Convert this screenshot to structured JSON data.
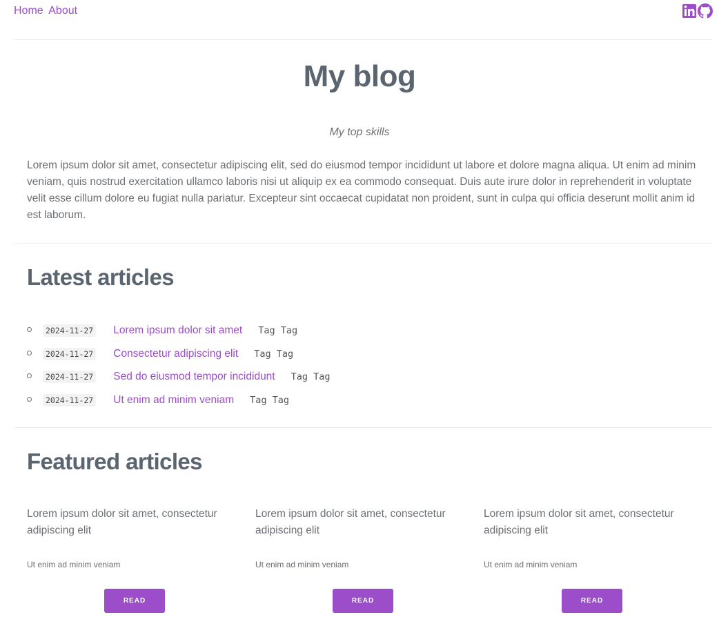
{
  "nav": {
    "links": [
      "Home",
      "About"
    ]
  },
  "social": {
    "icons": [
      "linkedin-icon",
      "github-icon"
    ],
    "accent": "#9b4dca"
  },
  "header": {
    "title": "My blog",
    "subtitle": "My top skills",
    "intro": "Lorem ipsum dolor sit amet, consectetur adipiscing elit, sed do eiusmod tempor incididunt ut labore et dolore magna aliqua. Ut enim ad minim veniam, quis nostrud exercitation ullamco laboris nisi ut aliquip ex ea commodo consequat. Duis aute irure dolor in reprehenderit in voluptate velit esse cillum dolore eu fugiat nulla pariatur. Excepteur sint occaecat cupidatat non proident, sunt in culpa qui officia deserunt mollit anim id est laborum."
  },
  "latest": {
    "heading": "Latest articles",
    "items": [
      {
        "date": "2024-11-27",
        "title": "Lorem ipsum dolor sit amet",
        "tags": "Tag Tag"
      },
      {
        "date": "2024-11-27",
        "title": "Consectetur adipiscing elit",
        "tags": "Tag Tag"
      },
      {
        "date": "2024-11-27",
        "title": "Sed do eiusmod tempor incididunt",
        "tags": "Tag Tag"
      },
      {
        "date": "2024-11-27",
        "title": "Ut enim ad minim veniam",
        "tags": "Tag Tag"
      }
    ]
  },
  "featured": {
    "heading": "Featured articles",
    "cards": [
      {
        "title": "Lorem ipsum dolor sit amet, consectetur adipiscing elit",
        "description": "Ut enim ad minim veniam",
        "button": "READ"
      },
      {
        "title": "Lorem ipsum dolor sit amet, consectetur adipiscing elit",
        "description": "Ut enim ad minim veniam",
        "button": "READ"
      },
      {
        "title": "Lorem ipsum dolor sit amet, consectetur adipiscing elit",
        "description": "Ut enim ad minim veniam",
        "button": "READ"
      }
    ]
  },
  "colors": {
    "accent": "#9b4dca",
    "heading": "#5a6570",
    "text": "#6b6f73"
  }
}
